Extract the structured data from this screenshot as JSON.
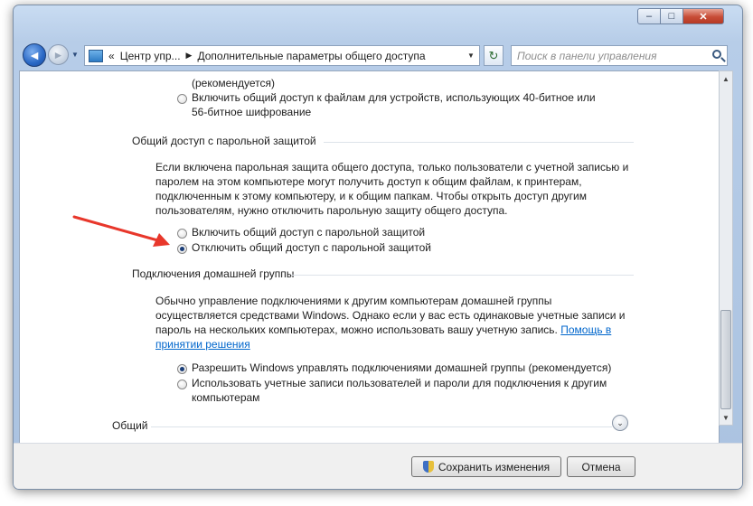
{
  "window": {
    "controls": {
      "minimize": "–",
      "maximize": "□",
      "close": "✕"
    }
  },
  "nav": {
    "back_glyph": "◄",
    "forward_glyph": "►",
    "history_glyph": "▼"
  },
  "address": {
    "prefix": "«",
    "segments": [
      "Центр упр...",
      "Дополнительные параметры общего доступа"
    ],
    "separator": "▶",
    "dropdown_glyph": "▼"
  },
  "refresh_glyph": "↻",
  "search": {
    "placeholder": "Поиск в панели управления"
  },
  "content": {
    "top": {
      "recommended_tail": "(рекомендуется)",
      "option_40_56": {
        "line1": "Включить общий доступ к файлам для устройств, использующих 40-битное или",
        "line2": "56-битное шифрование",
        "checked": false
      }
    },
    "password_section": {
      "title": "Общий доступ с парольной защитой",
      "description": [
        "Если включена парольная защита общего доступа, только пользователи с учетной записью и",
        "паролем на этом компьютере могут получить доступ к общим файлам, к принтерам,",
        "подключенным к этому компьютеру, и к общим папкам. Чтобы открыть доступ другим",
        "пользователям, нужно отключить парольную защиту общего доступа."
      ],
      "options": [
        {
          "label": "Включить общий доступ с парольной защитой",
          "checked": false
        },
        {
          "label": "Отключить общий доступ с парольной защитой",
          "checked": true
        }
      ]
    },
    "homegroup_section": {
      "title": "Подключения домашней группы",
      "description": [
        "Обычно управление подключениями к другим компьютерам домашней группы",
        "осуществляется средствами Windows. Однако если у вас есть одинаковые учетные записи и",
        "пароль на нескольких компьютерах, можно использовать вашу учетную запись."
      ],
      "help_link_part1": "Помощь в",
      "help_link_part2": "принятии решения",
      "options": [
        {
          "label": "Разрешить Windows управлять подключениями домашней группы (рекомендуется)",
          "checked": true
        },
        {
          "label": "Использовать учетные записи пользователей и пароли для подключения к другим",
          "label2": "компьютерам",
          "checked": false
        }
      ]
    },
    "general_section": {
      "title": "Общий",
      "expand_glyph": "⌄"
    }
  },
  "scrollbar": {
    "up_glyph": "▲",
    "down_glyph": "▼"
  },
  "footer": {
    "save_label": "Сохранить изменения",
    "cancel_label": "Отмена"
  },
  "colors": {
    "annotation_arrow": "#e8372b",
    "link": "#0066cc"
  }
}
